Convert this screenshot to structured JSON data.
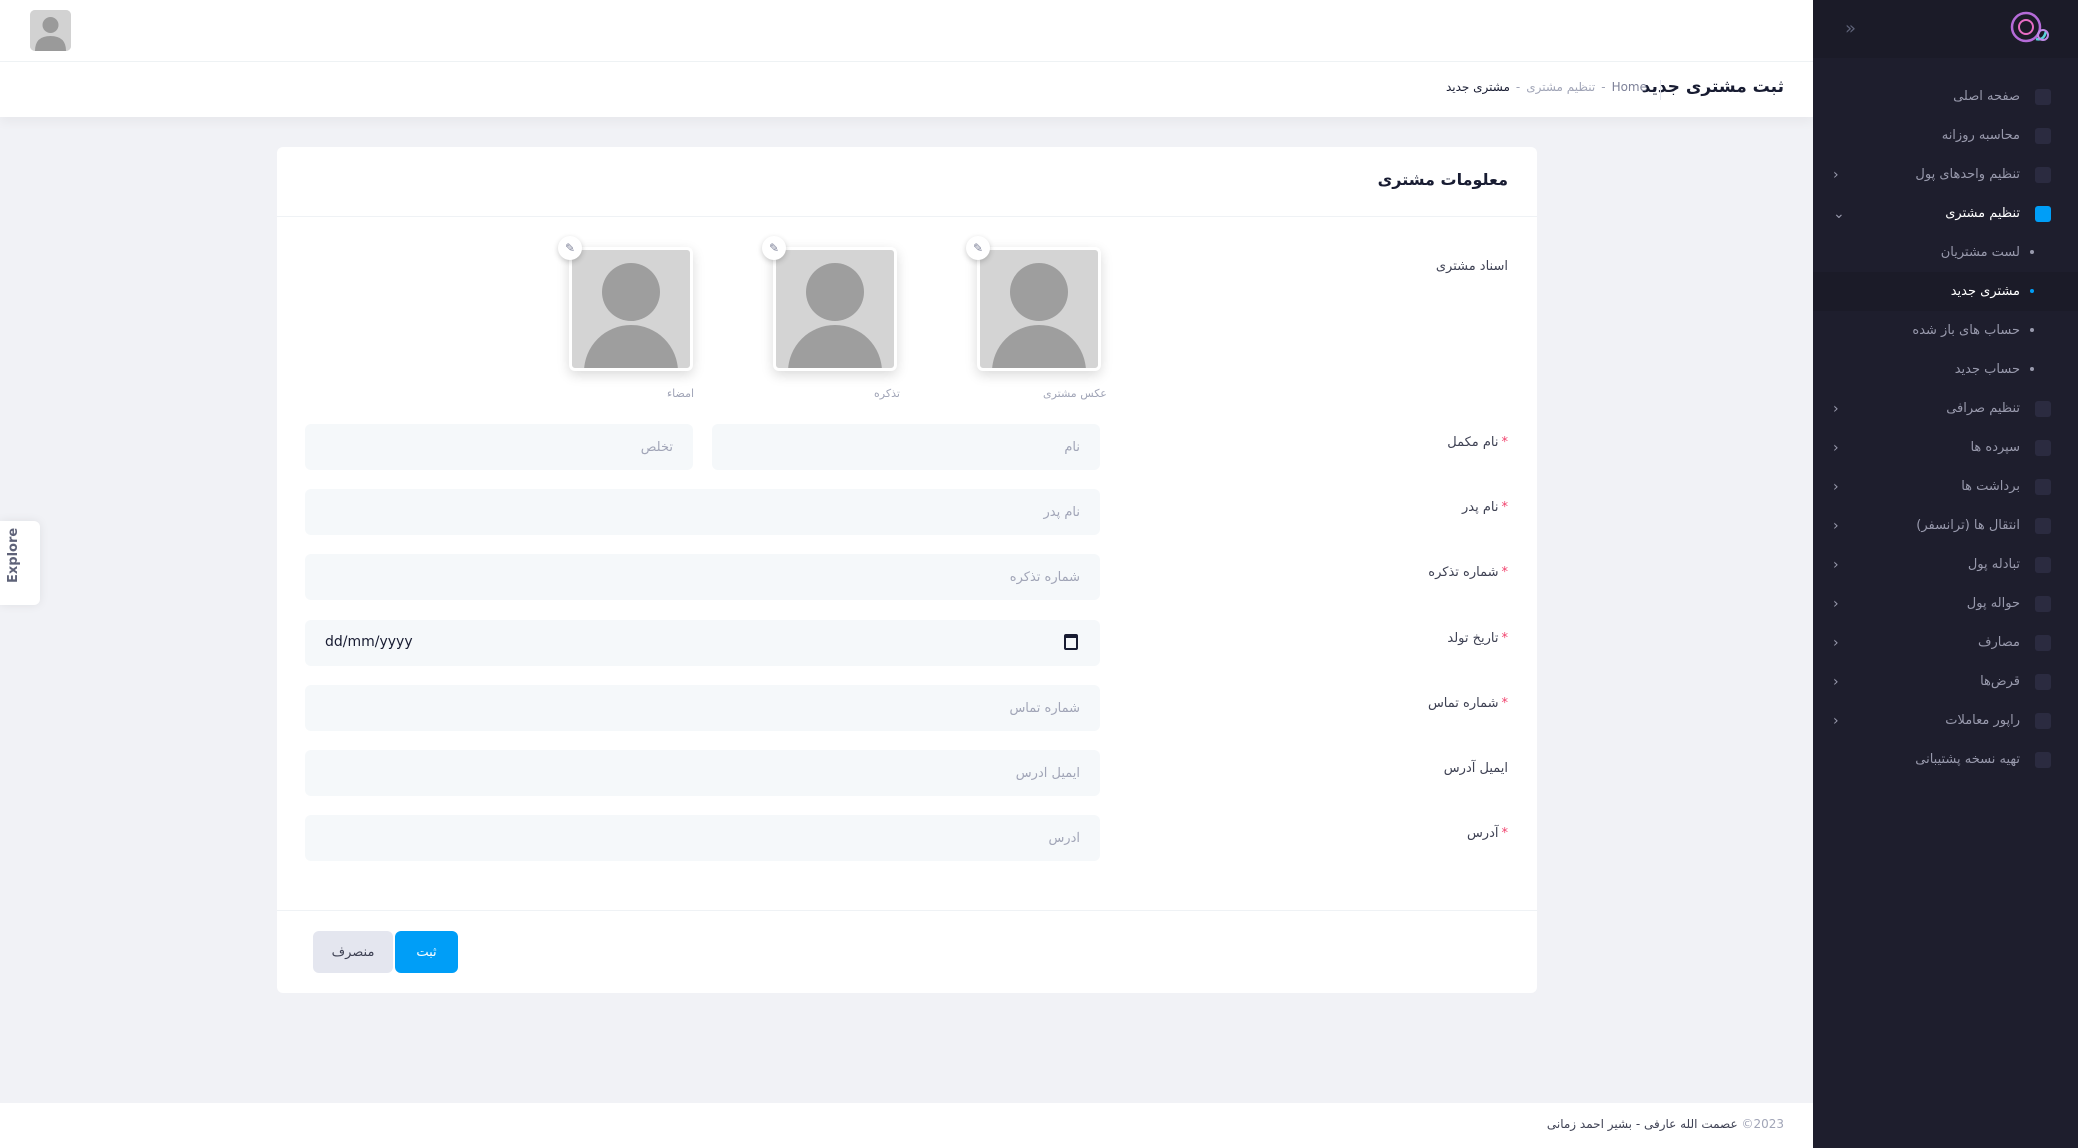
{
  "sidebar": {
    "items": [
      {
        "label": "صفحه اصلی",
        "icon": "dashboard-icon"
      },
      {
        "label": "محاسبه روزانه",
        "icon": "check-badge-icon"
      },
      {
        "label": "تنظیم واحدهای پول",
        "icon": "currency-icon",
        "chevron": "›"
      },
      {
        "label": "تنظیم مشتری",
        "icon": "card-icon",
        "chevron": "⌄"
      },
      {
        "label": "لست مشتریان"
      },
      {
        "label": "مشتری جدید"
      },
      {
        "label": "حساب های باز شده"
      },
      {
        "label": "حساب جدید"
      },
      {
        "label": "تنظیم صرافی",
        "icon": "exchange-icon",
        "chevron": "›"
      },
      {
        "label": "سپرده ها",
        "icon": "plus-icon",
        "chevron": "›"
      },
      {
        "label": "برداشت ها",
        "icon": "minus-icon",
        "chevron": "›"
      },
      {
        "label": "انتقال ها (ترانسفر)",
        "icon": "transfer-icon",
        "chevron": "›"
      },
      {
        "label": "تبادله پول",
        "icon": "swap-icon",
        "chevron": "›"
      },
      {
        "label": "حواله پول",
        "icon": "remittance-icon",
        "chevron": "›"
      },
      {
        "label": "مصارف",
        "icon": "expense-icon",
        "chevron": "›"
      },
      {
        "label": "قرض‌ها",
        "icon": "folder-icon",
        "chevron": "›"
      },
      {
        "label": "راپور معاملات",
        "icon": "calendar-icon",
        "chevron": "›"
      },
      {
        "label": "تهیه نسخه پشتیبانی",
        "icon": "backup-icon"
      }
    ],
    "collapse_icon": "»"
  },
  "toolbar": {
    "page_title": "ثبت مشتری جدید",
    "breadcrumb": {
      "home": "Home",
      "sep": "-",
      "parent": "تنظیم مشتری",
      "current": "مشتری جدید"
    }
  },
  "explore": {
    "label": "Explore"
  },
  "form": {
    "card_title": "معلومات مشتری",
    "documents_label": "اسناد مشتری",
    "photos": [
      {
        "caption": "عکس مشتری"
      },
      {
        "caption": "تذکره"
      },
      {
        "caption": "امضاء"
      }
    ],
    "edit_glyph": "✎",
    "required_mark": "*",
    "fields": {
      "full_name": {
        "label": "نام مکمل",
        "first_placeholder": "نام",
        "last_placeholder": "تخلص"
      },
      "father_name": {
        "label": "نام پدر",
        "placeholder": "نام پدر"
      },
      "tazkira": {
        "label": "شماره تذکره",
        "placeholder": "شماره تذکره"
      },
      "dob": {
        "label": "تاریخ تولد",
        "value": "dd/mm/yyyy"
      },
      "phone": {
        "label": "شماره تماس",
        "placeholder": "شماره تماس"
      },
      "email": {
        "label": "ایمیل آدرس",
        "placeholder": "ایمیل آدرس"
      },
      "address": {
        "label": "آدرس",
        "placeholder": "آدرس"
      }
    },
    "submit_label": "ثبت",
    "cancel_label": "منصرف"
  },
  "footer": {
    "year": "2023©",
    "authors": "عصمت الله عارفی - بشیر احمد زمانی"
  },
  "colors": {
    "sidebar_bg": "#1e1e2d",
    "accent": "#009ef7",
    "required": "#f1416c"
  }
}
